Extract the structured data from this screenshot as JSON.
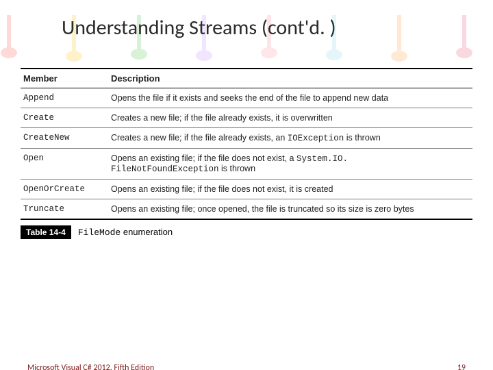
{
  "title": "Understanding Streams (cont'd. )",
  "table": {
    "headers": {
      "member": "Member",
      "description": "Description"
    },
    "rows": [
      {
        "member": "Append",
        "desc_pre": "Opens the file if it exists and seeks the end of the file to append new data",
        "code1": "",
        "desc_mid": "",
        "code2": "",
        "desc_post": ""
      },
      {
        "member": "Create",
        "desc_pre": "Creates a new file; if the file already exists, it is overwritten",
        "code1": "",
        "desc_mid": "",
        "code2": "",
        "desc_post": ""
      },
      {
        "member": "CreateNew",
        "desc_pre": "Creates a new file; if the file already exists, an ",
        "code1": "IOException",
        "desc_mid": " is thrown",
        "code2": "",
        "desc_post": ""
      },
      {
        "member": "Open",
        "desc_pre": "Opens an existing file; if the file does not exist, a ",
        "code1": "System.IO.",
        "desc_mid": "",
        "code2": "FileNotFoundException",
        "desc_post": " is thrown"
      },
      {
        "member": "OpenOrCreate",
        "desc_pre": "Opens an existing file; if the file does not exist, it is created",
        "code1": "",
        "desc_mid": "",
        "code2": "",
        "desc_post": ""
      },
      {
        "member": "Truncate",
        "desc_pre": "Opens an existing file; once opened, the file is truncated so its size is zero bytes",
        "code1": "",
        "desc_mid": "",
        "code2": "",
        "desc_post": ""
      }
    ]
  },
  "caption": {
    "badge": "Table 14-4",
    "text_pre": "",
    "code": "FileMode",
    "text_post": " enumeration"
  },
  "footer": {
    "left": "Microsoft Visual C# 2012, Fifth Edition",
    "right": "19"
  },
  "decor_colors": [
    "#ff6666",
    "#ffcc33",
    "#66cc66",
    "#cc99ff",
    "#ff99aa",
    "#99ddee",
    "#ffaa55",
    "#ee6688"
  ]
}
